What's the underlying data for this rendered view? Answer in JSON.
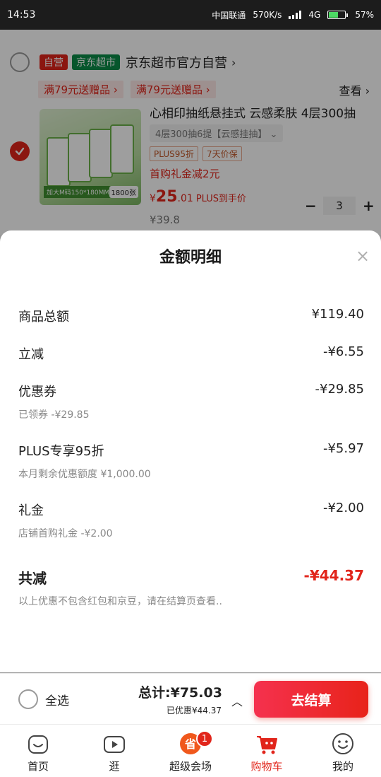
{
  "status_bar": {
    "time": "14:53",
    "carrier": "中国联通",
    "speed": "570K/s",
    "network": "4G",
    "battery": "57%",
    "battery_level": 0.57
  },
  "background_cart": {
    "store": {
      "tag_self_run": "自营",
      "tag_supermarket": "京东超市",
      "name": "京东超市官方自营",
      "promos": [
        "满79元送赠品",
        "满79元送赠品"
      ],
      "see_more": "查看"
    },
    "product": {
      "title": "心相印抽纸悬挂式 云感柔肤 4层300抽",
      "spec": "4层300抽6提【云感挂抽】",
      "tags": [
        "PLUS95折",
        "7天价保"
      ],
      "gift_note": "首购礼金减2元",
      "price_symbol": "¥",
      "price_int": "25",
      "price_dec": ".01",
      "price_note": "PLUS到手价",
      "original_price": "¥39.8",
      "quantity": "3",
      "minus": "−",
      "plus": "+",
      "image_label": "加大M码150*180MM",
      "image_count": "1800张"
    }
  },
  "sheet": {
    "title": "金额明细",
    "close": "×",
    "rows": [
      {
        "label": "商品总额",
        "amount": "¥119.40",
        "sub": ""
      },
      {
        "label": "立减",
        "amount": "-¥6.55",
        "sub": ""
      },
      {
        "label": "优惠券",
        "amount": "-¥29.85",
        "sub": "已领券 -¥29.85"
      },
      {
        "label": "PLUS专享95折",
        "amount": "-¥5.97",
        "sub": "本月剩余优惠额度 ¥1,000.00"
      },
      {
        "label": "礼金",
        "amount": "-¥2.00",
        "sub": "店铺首购礼金 -¥2.00"
      }
    ],
    "total": {
      "label": "共减",
      "amount": "-¥44.37"
    },
    "note": "以上优惠不包含红包和京豆，请在结算页查看.."
  },
  "checkout_bar": {
    "select_all": "全选",
    "total": "总计:¥75.03",
    "saved": "已优惠¥44.37",
    "caret": "︿",
    "checkout_button": "去结算"
  },
  "tabbar": {
    "items": [
      {
        "label": "首页",
        "icon": "home-icon"
      },
      {
        "label": "逛",
        "icon": "video-icon"
      },
      {
        "label": "超级会场",
        "icon": "venue-icon",
        "badge": "1"
      },
      {
        "label": "购物车",
        "icon": "cart-icon"
      },
      {
        "label": "我的",
        "icon": "profile-icon"
      }
    ]
  },
  "colors": {
    "brand_red": "#e1251b",
    "supermarket_green": "#0a8c48"
  }
}
